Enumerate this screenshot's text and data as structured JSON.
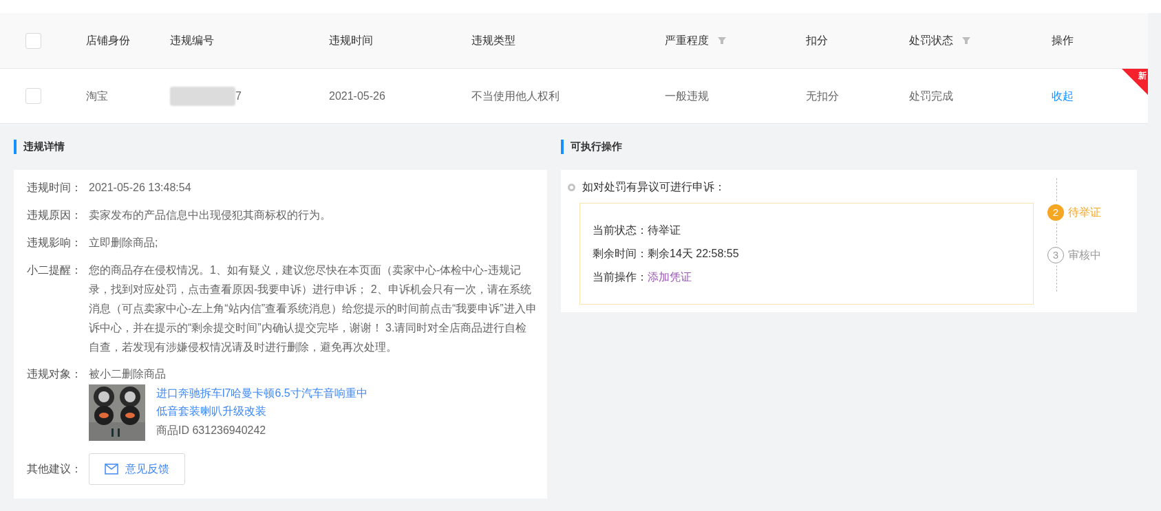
{
  "table": {
    "columns": [
      {
        "label": "店铺身份",
        "filter": false
      },
      {
        "label": "违规编号",
        "filter": false
      },
      {
        "label": "违规时间",
        "filter": false
      },
      {
        "label": "违规类型",
        "filter": false
      },
      {
        "label": "严重程度",
        "filter": true
      },
      {
        "label": "扣分",
        "filter": false
      },
      {
        "label": "处罚状态",
        "filter": true
      },
      {
        "label": "操作",
        "filter": false
      }
    ],
    "header_checked": false,
    "rows": [
      {
        "checked": false,
        "badge": "新",
        "cells": [
          "淘宝",
          "7",
          "2021-05-26",
          "不当使用他人权利",
          "一般违规",
          "无扣分",
          "处罚完成",
          "收起"
        ]
      }
    ]
  },
  "details": {
    "title": "违规详情",
    "fields": [
      {
        "label": "违规时间：",
        "value": "2021-05-26 13:48:54"
      },
      {
        "label": "违规原因：",
        "value": "卖家发布的产品信息中出现侵犯其商标权的行为。"
      },
      {
        "label": "违规影响：",
        "value": "立即删除商品;"
      },
      {
        "label": "小二提醒：",
        "value": "您的商品存在侵权情况。1、如有疑义，建议您尽快在本页面（卖家中心-体检中心-违规记录，找到对应处罚，点击查看原因-我要申诉）进行申诉； 2、申诉机会只有一次，请在系统消息（可点卖家中心-左上角“站内信”查看系统消息）给您提示的时间前点击“我要申诉”进入申诉中心，并在提示的“剩余提交时间”内确认提交完毕，谢谢！ 3.请同时对全店商品进行自检自查，若发现有涉嫌侵权情况请及时进行删除，避免再次处理。"
      }
    ],
    "object": {
      "label": "违规对象：",
      "value": "被小二删除商品",
      "product_title_lines": [
        "进口奔驰拆车l7哈曼卡顿6.5寸汽车音响重中",
        "低音套装喇叭升级改装"
      ],
      "product_id": "商品ID 631236940242"
    },
    "other": {
      "label": "其他建议：",
      "button": "意见反馈"
    }
  },
  "actions": {
    "title": "可执行操作",
    "intro": "如对处罚有异议可进行申诉：",
    "status": [
      {
        "label": "当前状态：",
        "value": "待举证",
        "kind": "text"
      },
      {
        "label": "剩余时间：",
        "value": "剩余14天 22:58:55",
        "kind": "text"
      },
      {
        "label": "当前操作：",
        "value": "添加凭证",
        "kind": "link"
      }
    ],
    "steps": [
      {
        "number": "2",
        "label": "待举证",
        "selected": true
      },
      {
        "number": "3",
        "label": "审核中",
        "selected": false
      }
    ]
  }
}
